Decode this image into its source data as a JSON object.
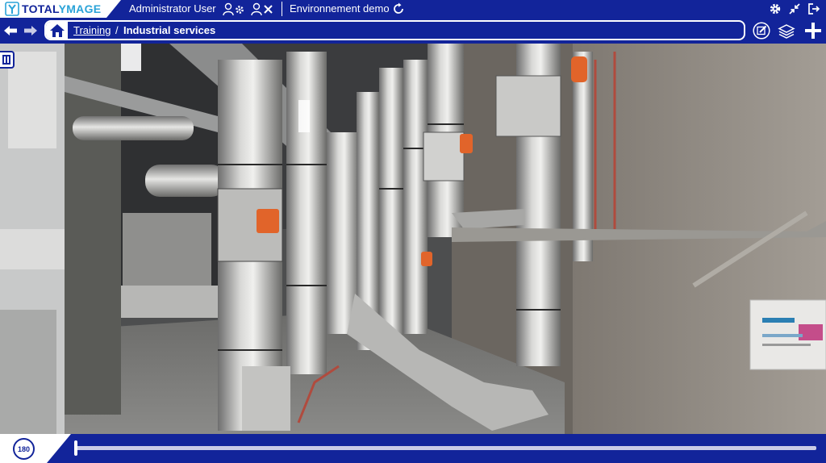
{
  "brand": {
    "name_part1": "TOTAL",
    "name_part2": "YMAGE"
  },
  "header": {
    "user_name": "Administrator User",
    "environment": "Environnement demo",
    "icons": [
      "users-settings-icon",
      "user-remove-icon",
      "refresh-icon",
      "settings-icon",
      "collapse-icon",
      "logout-icon"
    ]
  },
  "breadcrumb": {
    "parent": "Training",
    "separator": "/",
    "current": "Industrial services"
  },
  "toolbar_icons": [
    "back-arrow-icon",
    "forward-arrow-icon",
    "home-icon",
    "edit-icon",
    "layers-icon",
    "add-icon"
  ],
  "timeline": {
    "button_label": "180",
    "progress": 0.0
  },
  "colors": {
    "primary": "#12249a",
    "accent": "#2aa3d8",
    "white": "#ffffff"
  }
}
